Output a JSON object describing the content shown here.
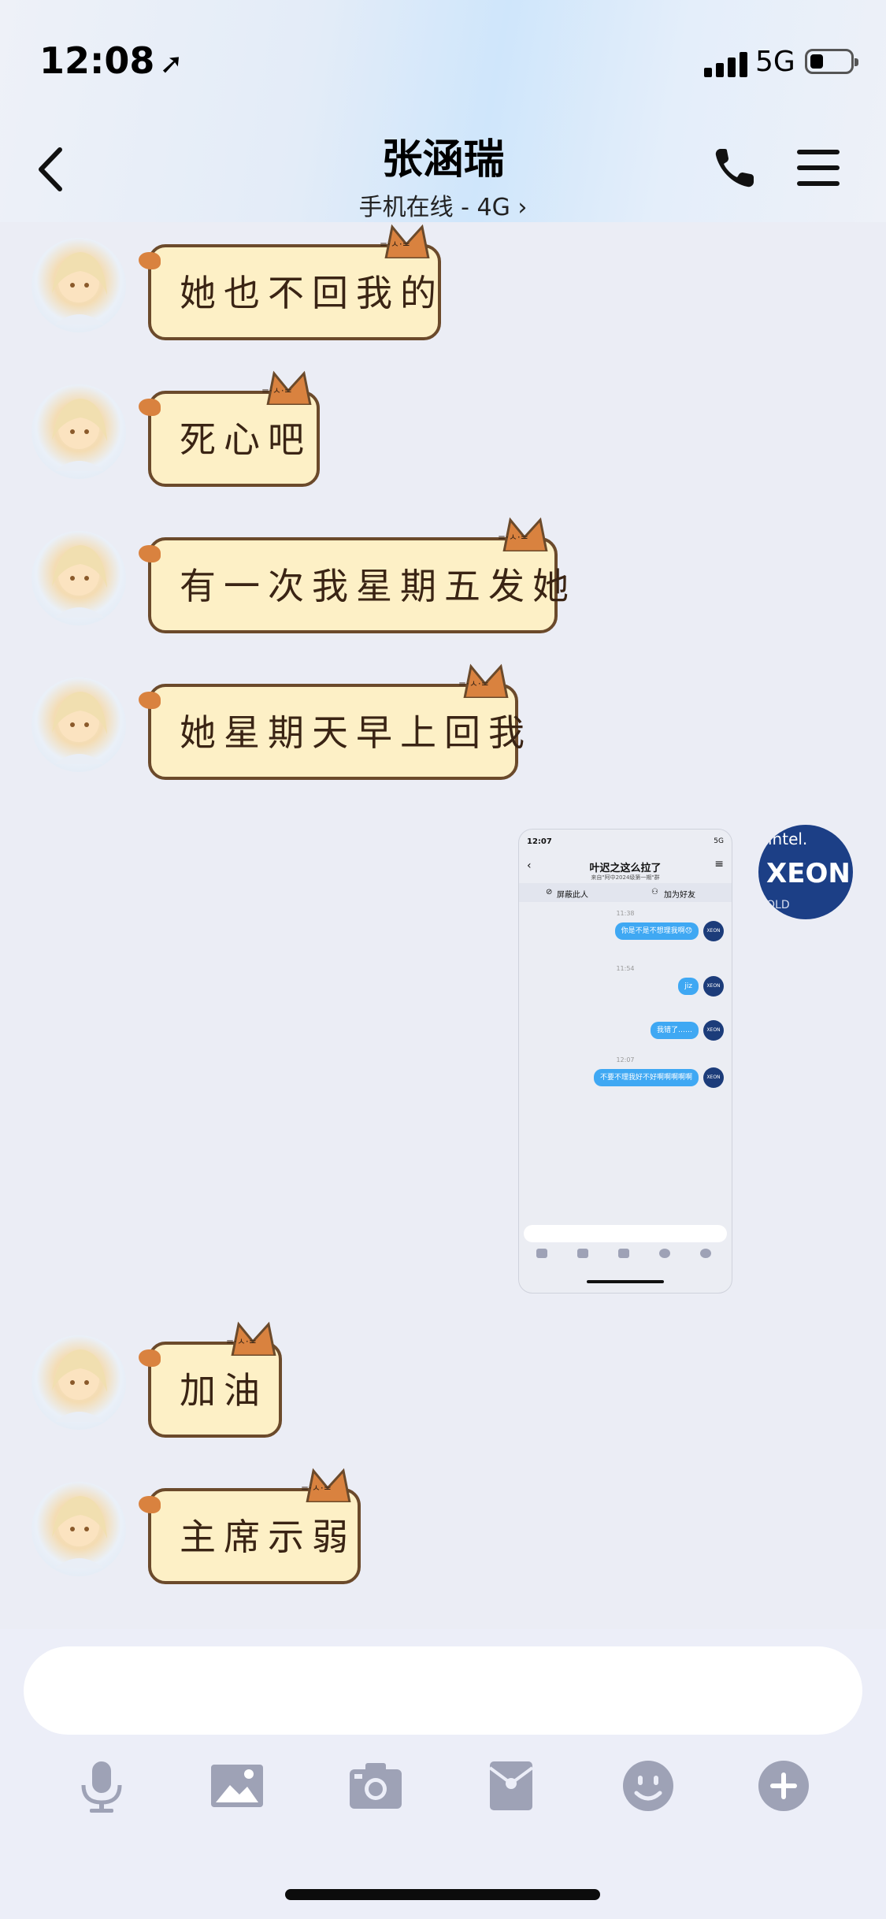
{
  "status_bar": {
    "time": "12:08",
    "network": "5G"
  },
  "header": {
    "title": "张涵瑞",
    "subtitle": "手机在线 - 4G"
  },
  "messages": [
    {
      "sender": "other",
      "text": "她也不回我的"
    },
    {
      "sender": "other",
      "text": "死心吧"
    },
    {
      "sender": "other",
      "text": "有一次我星期五发她"
    },
    {
      "sender": "other",
      "text": "她星期天早上回我"
    },
    {
      "sender": "self",
      "type": "image"
    },
    {
      "sender": "other",
      "text": "加油"
    },
    {
      "sender": "other",
      "text": "主席示弱"
    }
  ],
  "shared_screenshot": {
    "status_time": "12:07",
    "status_network": "5G",
    "title": "叶迟之这么拉了",
    "subtitle": "来自\"阿中2024级第一期\"群",
    "actions": [
      "屏蔽此人",
      "加为好友"
    ],
    "timestamps": [
      "11:38",
      "11:54",
      "12:07"
    ],
    "bubbles": [
      "你是不是不想理我啊😞",
      "jiz",
      "我错了……",
      "不要不理我好不好啊啊啊啊啊"
    ],
    "avatar_text": "XEON"
  },
  "self_avatar": {
    "line1": "intel.",
    "line2": "XEON",
    "line3": "OLD"
  },
  "toolbar_icons": [
    "microphone-icon",
    "image-icon",
    "camera-icon",
    "red-packet-icon",
    "emoji-icon",
    "plus-icon"
  ],
  "colors": {
    "bubble_bg": "#fdf0c6",
    "bubble_border": "#6b4a2b",
    "shot_bubble": "#3fa8f3",
    "toolbar_icon": "#9ea2b6"
  }
}
